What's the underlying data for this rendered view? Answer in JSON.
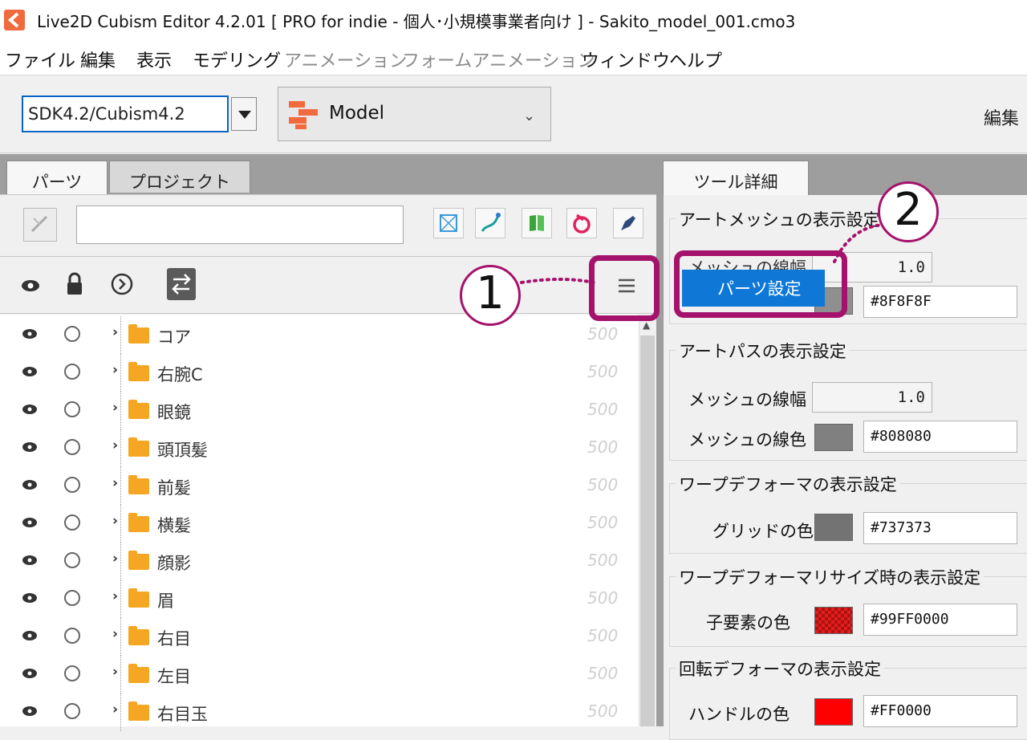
{
  "window": {
    "title": "Live2D Cubism Editor 4.2.01   [ PRO for indie - 個人･小規模事業者向け ] - Sakito_model_001.cmo3"
  },
  "menu": [
    {
      "label": "ファイル",
      "enabled": true
    },
    {
      "label": "編集",
      "enabled": true
    },
    {
      "label": "表示",
      "enabled": true
    },
    {
      "label": "モデリング",
      "enabled": true
    },
    {
      "label": "アニメーション",
      "enabled": false
    },
    {
      "label": "フォームアニメーション",
      "enabled": false
    },
    {
      "label": "ウィンドウ",
      "enabled": true
    },
    {
      "label": "ヘルプ",
      "enabled": true
    }
  ],
  "toolbar": {
    "sdk_value": "SDK4.2/Cubism4.2",
    "workspace_label": "Model",
    "edit_label": "編集"
  },
  "tabs": {
    "left": [
      "パーツ",
      "プロジェクト"
    ],
    "right": "ツール詳細"
  },
  "parts": [
    {
      "name": "コア",
      "value": "500"
    },
    {
      "name": "右腕C",
      "value": "500"
    },
    {
      "name": "眼鏡",
      "value": "500"
    },
    {
      "name": "頭頂髪",
      "value": "500"
    },
    {
      "name": "前髪",
      "value": "500"
    },
    {
      "name": "横髪",
      "value": "500"
    },
    {
      "name": "顔影",
      "value": "500"
    },
    {
      "name": "眉",
      "value": "500"
    },
    {
      "name": "右目",
      "value": "500"
    },
    {
      "name": "左目",
      "value": "500"
    },
    {
      "name": "右目玉",
      "value": "500"
    }
  ],
  "context_menu": {
    "item": "パーツ設定"
  },
  "tool_detail": {
    "art_mesh": {
      "title": "アートメッシュの表示設定",
      "width_label": "メッシュの線幅",
      "width_value": "1.0",
      "color_value": "#8F8F8F"
    },
    "art_path": {
      "title": "アートパスの表示設定",
      "width_label": "メッシュの線幅",
      "width_value": "1.0",
      "color_label": "メッシュの線色",
      "color_value": "#808080"
    },
    "warp": {
      "title": "ワープデフォーマの表示設定",
      "grid_label": "グリッドの色",
      "grid_value": "#737373"
    },
    "warp_resize": {
      "title": "ワープデフォーマリサイズ時の表示設定",
      "child_label": "子要素の色",
      "child_value": "#99FF0000"
    },
    "rotation": {
      "title": "回転デフォーマの表示設定",
      "handle_label": "ハンドルの色",
      "handle_value": "#FF0000"
    }
  },
  "annotations": {
    "one": "1",
    "two": "2"
  },
  "colors": {
    "accent": "#f06a3e",
    "highlight": "#a5126c",
    "selection": "#0f78d7",
    "folder": "#f5a623"
  }
}
